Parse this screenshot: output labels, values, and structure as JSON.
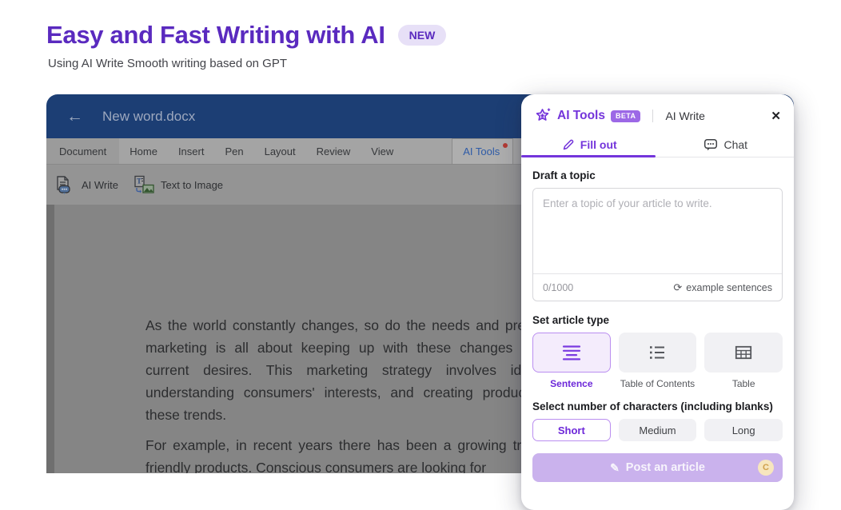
{
  "hero": {
    "title": "Easy and Fast Writing with AI",
    "badge": "NEW",
    "subtitle": "Using AI Write Smooth writing based on GPT"
  },
  "window": {
    "title": "New word.docx",
    "tabs": [
      {
        "label": "Document"
      },
      {
        "label": "Home"
      },
      {
        "label": "Insert"
      },
      {
        "label": "Pen"
      },
      {
        "label": "Layout"
      },
      {
        "label": "Review"
      },
      {
        "label": "View"
      },
      {
        "label": "AI Tools",
        "active": true,
        "notification_dot": true
      }
    ],
    "toolbar": [
      {
        "label": "AI Write"
      },
      {
        "label": "Text to Image"
      }
    ],
    "document": {
      "paragraphs": [
        {
          "lines": [
            "As the world constantly changes, so do the needs and pref",
            "marketing is all about keeping up with these changes a",
            "current desires. This marketing strategy involves ide",
            "understanding consumers' interests, and creating product",
            "these trends."
          ]
        },
        {
          "lines": [
            "For example, in recent years there has been a growing tre",
            "friendly products. Conscious consumers are looking for"
          ]
        }
      ]
    }
  },
  "panel": {
    "title": "AI Tools",
    "beta_badge": "BETA",
    "tool_name": "AI Write",
    "tabs": [
      {
        "label": "Fill out",
        "active": true
      },
      {
        "label": "Chat"
      }
    ],
    "draft": {
      "label": "Draft a topic",
      "placeholder": "Enter a topic of your article to write.",
      "counter": "0/1000",
      "example_button": "example sentences"
    },
    "article_type": {
      "label": "Set article type",
      "options": [
        {
          "label": "Sentence",
          "selected": true
        },
        {
          "label": "Table of Contents",
          "selected": false
        },
        {
          "label": "Table",
          "selected": false
        }
      ]
    },
    "char_count": {
      "label": "Select number of characters (including blanks)",
      "options": [
        {
          "label": "Short",
          "selected": true
        },
        {
          "label": "Medium",
          "selected": false
        },
        {
          "label": "Long",
          "selected": false
        }
      ]
    },
    "post_button": {
      "label": "Post an article",
      "credit_letter": "C"
    }
  },
  "icons": {
    "back": "←",
    "close": "✕",
    "refresh": "⟳",
    "pencil": "✎"
  },
  "colors": {
    "accent_purple": "#7435DB",
    "heading_purple": "#5A2ABF",
    "titlebar_navy": "#1C3E74",
    "beta_bg": "#9C68E6",
    "selected_bg": "#F4ECFC",
    "selected_border": "#BA8EF0",
    "post_button_bg": "#CAB2ED",
    "coin_bg": "#F7E6BE",
    "coin_text": "#CFA04C",
    "ai_tab_text": "#2E5BA7",
    "notification_red": "#B23A34"
  }
}
